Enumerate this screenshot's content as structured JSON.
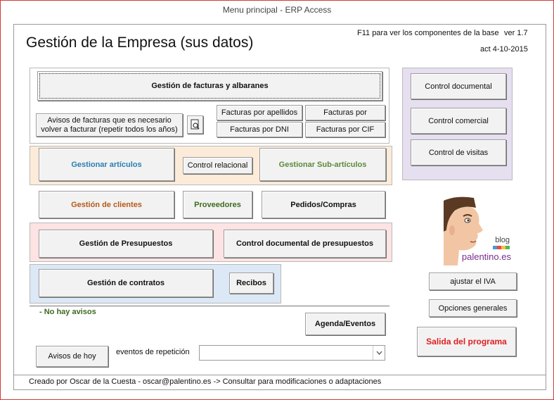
{
  "window": {
    "title": "Menu principal - ERP Access"
  },
  "header": {
    "title": "Gestión de la Empresa (sus datos)",
    "f11_hint": "F11 para ver los componentes de la base",
    "version": "ver 1.7",
    "updated": "act 4-10-2015"
  },
  "buttons": {
    "facturas_albaranes": "Gestión  de facturas y albaranes",
    "avisos_facturas": "Avisos de facturas que es necesario volver a facturar (repetir todos los años)",
    "facturas_apellidos": "Facturas por apellidos",
    "facturas_por": "Facturas por",
    "facturas_dni": "Facturas por DNI",
    "facturas_cif": "Facturas por CIF",
    "gestionar_articulos": "Gestionar artículos",
    "control_relacional": "Control relacional",
    "gestionar_subarticulos": "Gestionar Sub-artículos",
    "gestion_clientes": "Gestión de clientes",
    "proveedores": "Proveedores",
    "pedidos_compras": "Pedidos/Compras",
    "gestion_presupuestos": "Gestión de Presupuestos",
    "control_doc_presupuestos": "Control documental de presupuestos",
    "gestion_contratos": "Gestión de contratos",
    "recibos": "Recibos",
    "agenda_eventos": "Agenda/Eventos",
    "avisos_hoy": "Avisos de hoy",
    "control_documental": "Control documental",
    "control_comercial": "Control comercial",
    "control_visitas": "Control de visitas",
    "ajustar_iva": "ajustar el IVA",
    "opciones_generales": "Opciones generales",
    "salida": "Salida del programa"
  },
  "status": {
    "no_avisos": "- No hay avisos"
  },
  "eventos": {
    "label": "eventos de repetición",
    "value": ""
  },
  "logo": {
    "blog": "blog",
    "site": "palentino.es"
  },
  "footer": {
    "credit": "Creado por Oscar de la Cuesta - oscar@palentino.es -> Consultar para modificaciones o adaptaciones"
  },
  "colors": {
    "articulos_text": "#2a7fb0",
    "subarticulos_text": "#5c8a3a",
    "clientes_text": "#b55a1a",
    "proveedores_text": "#3d6b1f",
    "salida_text": "#e02020",
    "avisos_green": "#3d6b1f"
  }
}
